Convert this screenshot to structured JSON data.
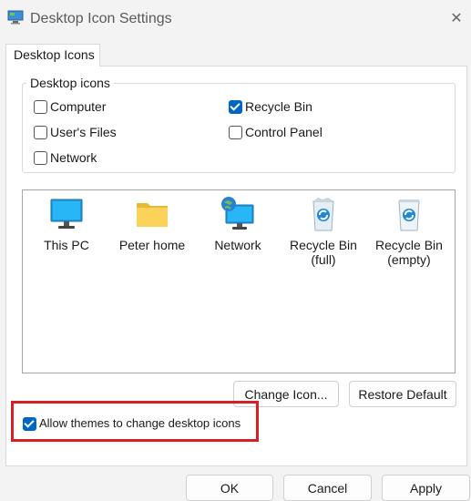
{
  "window": {
    "title": "Desktop Icon Settings",
    "title_icon": "desktop-settings-icon",
    "close_icon": "close-icon"
  },
  "tab": {
    "label": "Desktop Icons"
  },
  "group": {
    "label": "Desktop icons",
    "items": [
      {
        "label": "Computer",
        "checked": false
      },
      {
        "label": "Recycle Bin",
        "checked": true
      },
      {
        "label": "User's Files",
        "checked": false
      },
      {
        "label": "Control Panel",
        "checked": false
      },
      {
        "label": "Network",
        "checked": false
      }
    ]
  },
  "icons": [
    {
      "label": "This PC",
      "icon": "monitor-icon"
    },
    {
      "label": "Peter home",
      "icon": "folder-icon"
    },
    {
      "label": "Network",
      "icon": "network-icon"
    },
    {
      "label": "Recycle Bin\n(full)",
      "label_line1": "Recycle Bin",
      "label_line2": "(full)",
      "icon": "recycle-bin-full-icon"
    },
    {
      "label_line1": "Recycle Bin",
      "label_line2": "(empty)",
      "icon": "recycle-bin-empty-icon"
    }
  ],
  "buttons": {
    "change_icon": "Change Icon...",
    "restore_default": "Restore Default",
    "ok": "OK",
    "cancel": "Cancel",
    "apply": "Apply"
  },
  "allow_themes": {
    "label": "Allow themes to change desktop icons",
    "checked": true
  },
  "colors": {
    "accent": "#0067c0",
    "highlight": "#d81e27"
  }
}
